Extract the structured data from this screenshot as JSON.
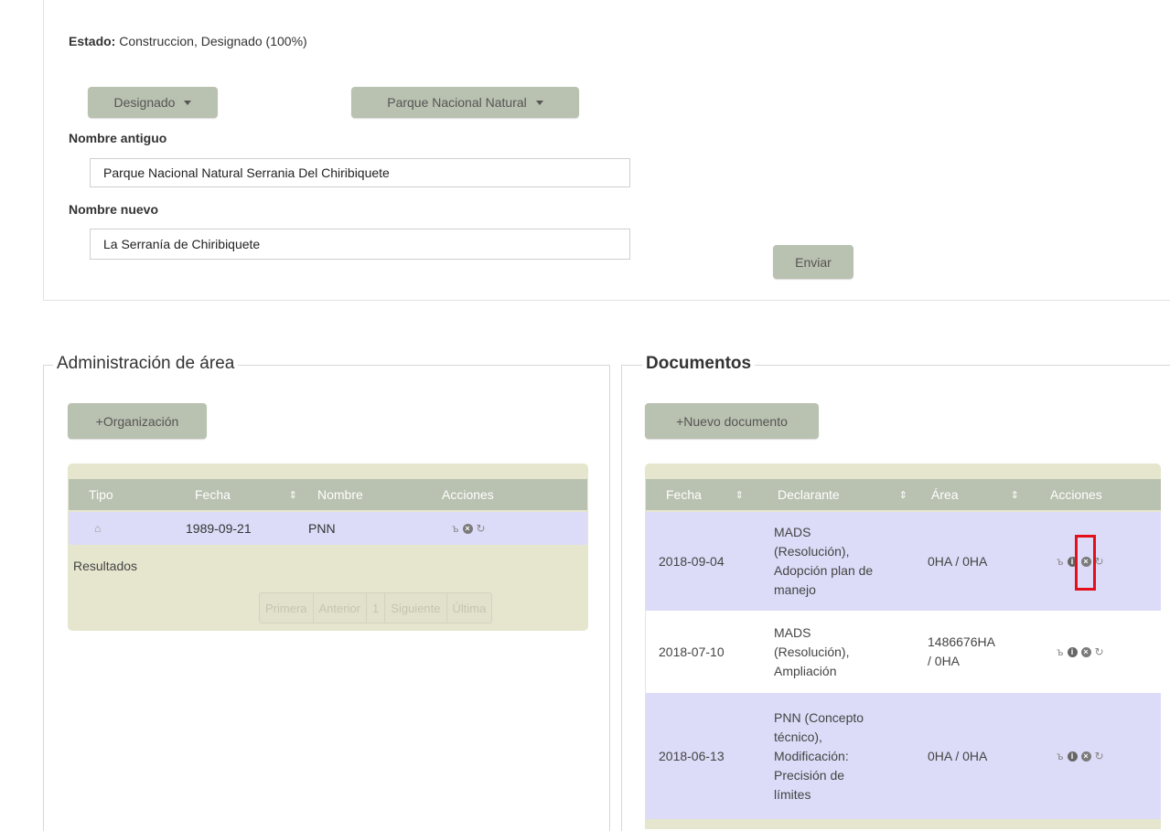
{
  "status": {
    "label": "Estado:",
    "value": "Construccion, Designado (100%)"
  },
  "selects": {
    "estado": "Designado",
    "tipo": "Parque Nacional Natural"
  },
  "form": {
    "old_name_label": "Nombre antiguo",
    "old_name_value": "Parque Nacional Natural Serrania Del Chiribiquete",
    "new_name_label": "Nombre nuevo",
    "new_name_value": "La Serranía de Chiribiquete",
    "submit_label": "Enviar"
  },
  "admin": {
    "title": "Administración de área",
    "add_label": "+Organización",
    "columns": [
      "Tipo",
      "Fecha",
      "Nombre",
      "Acciones"
    ],
    "rows": [
      {
        "tipo_icon": "home-icon",
        "fecha": "1989-09-21",
        "nombre": "PNN"
      }
    ],
    "results_label": "Resultados",
    "pager": [
      "Primera",
      "Anterior",
      "1",
      "Siguiente",
      "Última"
    ]
  },
  "documents": {
    "title": "Documentos",
    "add_label": "+Nuevo documento",
    "columns": [
      "Fecha",
      "Declarante",
      "Área",
      "Acciones"
    ],
    "rows": [
      {
        "fecha": "2018-09-04",
        "declarante": [
          "MADS",
          "(Resolución),",
          "Adopción plan de",
          "manejo"
        ],
        "area": [
          "0HA / 0HA"
        ]
      },
      {
        "fecha": "2018-07-10",
        "declarante": [
          "MADS",
          "(Resolución),",
          "Ampliación"
        ],
        "area": [
          "1486676HA",
          "/ 0HA"
        ]
      },
      {
        "fecha": "2018-06-13",
        "declarante": [
          "PNN (Concepto",
          "técnico),",
          "Modificación:",
          "Precisión de",
          "límites"
        ],
        "area": [
          "0HA / 0HA"
        ]
      }
    ]
  },
  "colors": {
    "pill_bg": "#b9c1b0",
    "table_bg": "#e6e6cf",
    "row_highlight": "#dcdcf8",
    "highlight_box": "#e3101c"
  }
}
